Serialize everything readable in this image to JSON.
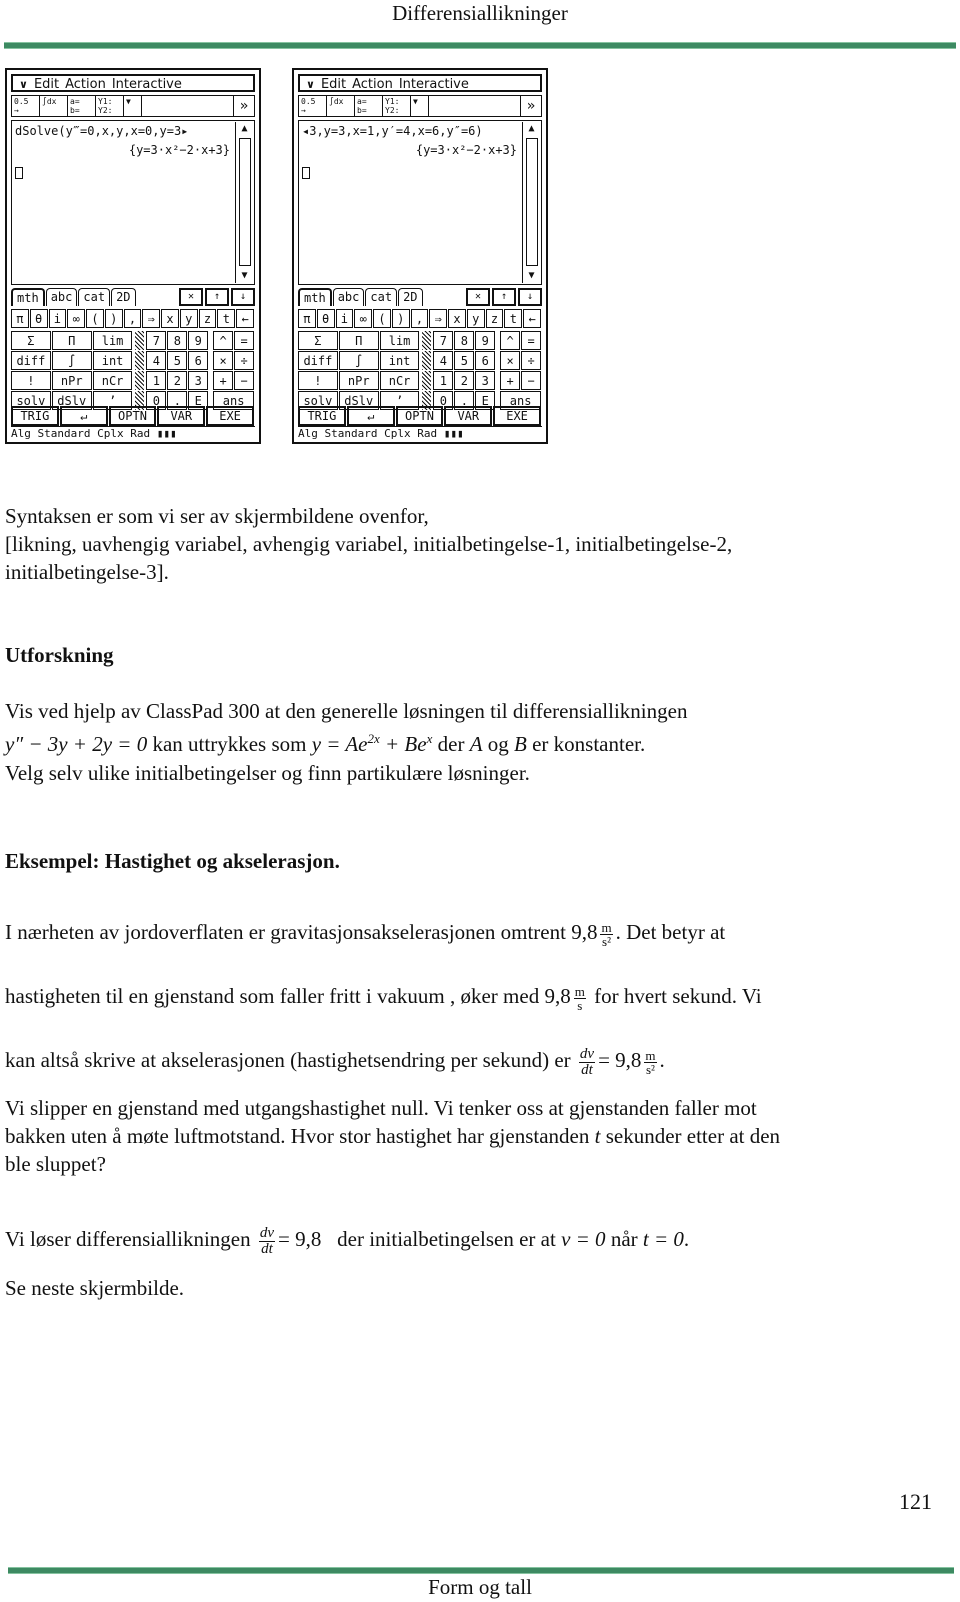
{
  "header": {
    "title": "Differensiallikninger"
  },
  "footer": {
    "page_number": "121",
    "book_title": "Form og tall"
  },
  "calculators": [
    {
      "menu": {
        "chevron": "∨",
        "items": [
          "Edit",
          "Action",
          "Interactive"
        ]
      },
      "toolbar": [
        "0.5 → 1/2",
        "∫dx",
        "a= b=",
        "Y1: Y2:",
        "▼",
        "»"
      ],
      "input_line": "dSolve(y‴=0,x,y,x=0,y=3▸",
      "result_line": "{y=3·x²−2·x+3}",
      "tabs": [
        "mth",
        "abc",
        "cat",
        "2D"
      ],
      "tab_icons": [
        "✕",
        "↑",
        "↓"
      ]
    },
    {
      "menu": {
        "chevron": "∨",
        "items": [
          "Edit",
          "Action",
          "Interactive"
        ]
      },
      "toolbar": [
        "0.5 → 1/2",
        "∫dx",
        "a= b=",
        "Y1: Y2:",
        "▼",
        "»"
      ],
      "input_line": "◂3,y=3,x=1,y′=4,x=6,y″=6)",
      "result_line": "{y=3·x²−2·x+3}",
      "tabs": [
        "mth",
        "abc",
        "cat",
        "2D"
      ],
      "tab_icons": [
        "✕",
        "↑",
        "↓"
      ]
    }
  ],
  "keypad": {
    "symbols": [
      "π",
      "θ",
      "i",
      "∞",
      "(",
      ")",
      ",",
      "⇒",
      "x",
      "y",
      "z",
      "t",
      "←"
    ],
    "rows": [
      {
        "func": [
          "Σ",
          "Π",
          "lim"
        ],
        "num": [
          "7",
          "8",
          "9"
        ],
        "ops": [
          "^",
          "="
        ]
      },
      {
        "func": [
          "diff",
          "∫",
          "int"
        ],
        "num": [
          "4",
          "5",
          "6"
        ],
        "ops": [
          "×",
          "÷"
        ]
      },
      {
        "func": [
          "!",
          "nPr",
          "nCr"
        ],
        "num": [
          "1",
          "2",
          "3"
        ],
        "ops": [
          "+",
          "−"
        ]
      },
      {
        "func": [
          "solv",
          "dSlv",
          "’"
        ],
        "num": [
          "0",
          ".",
          "E"
        ],
        "ops": [
          "ans"
        ]
      }
    ],
    "fkeys": [
      "TRIG",
      "↵",
      "OPTN",
      "VAR",
      "EXE"
    ],
    "status": "Alg    Standard Cplx Rad"
  },
  "body": {
    "p1": [
      "Syntaksen er som vi ser av skjermbildene ovenfor,",
      "[likning, uavhengig variabel, avhengig variabel, initialbetingelse-1, initialbetingelse-2,",
      "initialbetingelse-3]."
    ],
    "heading_explore": "Utforskning",
    "explore": {
      "line1": "Vis ved hjelp av ClassPad 300 at den generelle løsningen til differensiallikningen",
      "eq1": "y″ − 3y + 2y = 0",
      "mid": "kan uttrykkes som",
      "eq2_lhs": "y = Ae",
      "eq2_exp1": "2x",
      "eq2_mid": " + Be",
      "eq2_exp2": "x",
      "tail_1": "der",
      "var_a": "A",
      "tail_2": "og",
      "var_b": "B",
      "tail_3": "er konstanter.",
      "line3": "Velg selv ulike initialbetingelser og finn partikulære løsninger."
    },
    "heading_example": "Eksempel: Hastighet og akselerasjon.",
    "example": {
      "l1_text": "I nærheten av jordoverflaten er gravitasjonsakselerasjonen omtrent",
      "l1_value": "9,8",
      "unit_num": "m",
      "unit_den_s2": "s²",
      "unit_den_s": "s",
      "l1_tail": ". Det betyr at",
      "l2_text": "hastigheten til en gjenstand som faller fritt i vakuum , øker med",
      "l2_value": "9,8",
      "l2_tail": "for hvert sekund. Vi",
      "l3_text": "kan altså skrive at akselerasjonen (hastighetsendring per sekund) er",
      "dv": "dv",
      "dt": "dt",
      "l3_eq": "= 9,8",
      "l3_tail": ".",
      "p2": [
        "Vi slipper en gjenstand med utgangshastighet null. Vi tenker oss at gjenstanden faller mot",
        "bakken uten å møte luftmotstand. Hvor stor hastighet har gjenstanden",
        "ble sluppet?"
      ],
      "p2_var_t": "t",
      "p2_tail": "sekunder etter at den",
      "l4_text": "Vi løser differensiallikningen",
      "l4_eq": "= 9,8",
      "l4_mid": "der initialbetingelsen er at",
      "l4_cond1": "v = 0",
      "l4_when": "når",
      "l4_cond2": "t = 0",
      "l4_tail": ".",
      "l5": "Se neste skjermbilde."
    }
  },
  "colors": {
    "rule": "#3d8a62"
  }
}
